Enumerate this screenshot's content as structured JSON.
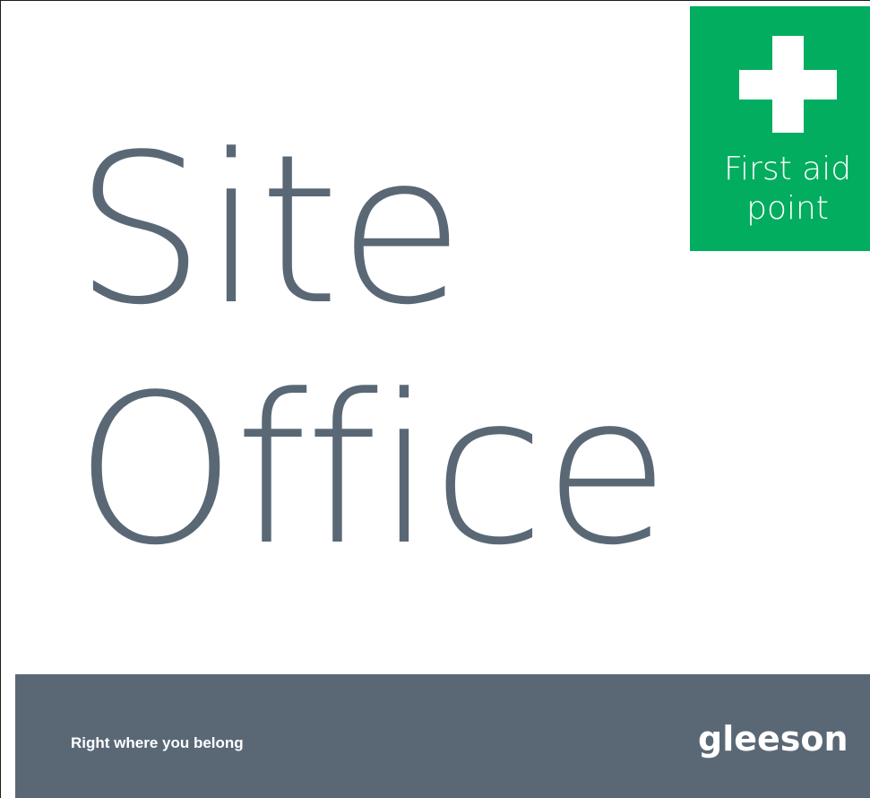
{
  "sign": {
    "title_line_1": "Site",
    "title_line_2": "Office",
    "first_aid": {
      "label": "First aid\npoint",
      "icon": "plus-cross-icon",
      "background_color": "#03ad5f"
    },
    "footer": {
      "tagline": "Right where you belong",
      "logo_text": "gleeson",
      "background_color": "#5a6876"
    },
    "text_color": "#5a6876"
  }
}
